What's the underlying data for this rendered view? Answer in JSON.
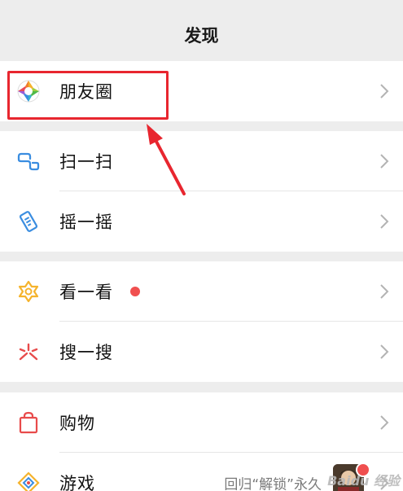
{
  "header": {
    "title": "发现"
  },
  "groups": {
    "moments": {
      "label": "朋友圈"
    },
    "scan": {
      "label": "扫一扫"
    },
    "shake": {
      "label": "摇一摇"
    },
    "top_stories": {
      "label": "看一看"
    },
    "search": {
      "label": "搜一搜"
    },
    "shopping": {
      "label": "购物"
    },
    "games": {
      "label": "游戏",
      "extra_text": "回归“解锁”永久"
    }
  },
  "watermark": {
    "text": "Baidu 经验"
  },
  "icons": {
    "moments": "aperture-icon",
    "scan": "scan-icon",
    "shake": "shake-icon",
    "top_stories": "top-stories-icon",
    "search": "search-star-icon",
    "shopping": "shopping-bag-icon",
    "games": "games-diamond-icon",
    "chevron": "chevron-right-icon"
  },
  "colors": {
    "highlight": "#e8262f",
    "badge": "#f04f4f",
    "background": "#ededed",
    "row": "#ffffff"
  }
}
